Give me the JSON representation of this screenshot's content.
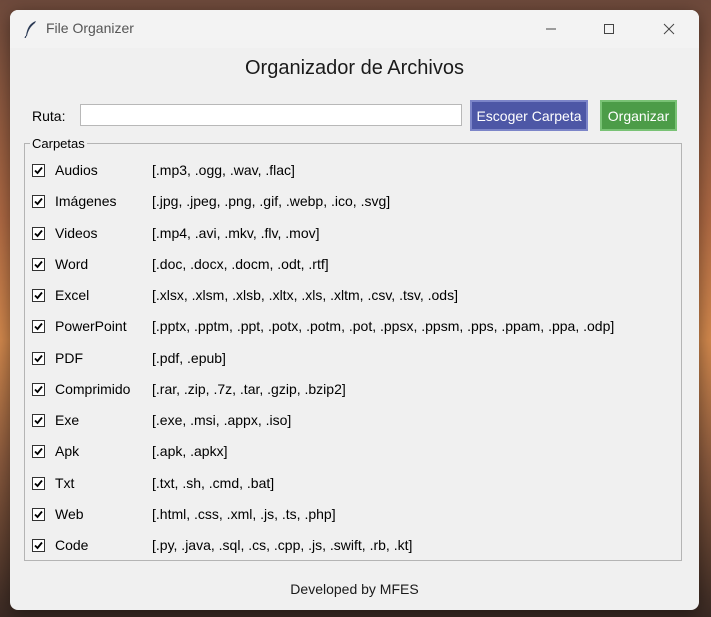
{
  "window": {
    "title": "File Organizer",
    "controls": {
      "minimize_icon": "minimize-icon",
      "maximize_icon": "maximize-icon",
      "close_icon": "close-icon"
    }
  },
  "header": {
    "title": "Organizador de Archivos"
  },
  "path": {
    "label": "Ruta:",
    "value": "",
    "placeholder": ""
  },
  "buttons": {
    "choose_folder": "Escoger Carpeta",
    "organize": "Organizar"
  },
  "colors": {
    "choose_button": "#4d57a6",
    "organize_button": "#4c9c48"
  },
  "folders": {
    "legend": "Carpetas",
    "items": [
      {
        "name": "Audios",
        "extensions": "[.mp3, .ogg, .wav, .flac]",
        "checked": true
      },
      {
        "name": "Imágenes",
        "extensions": "[.jpg, .jpeg, .png, .gif, .webp, .ico, .svg]",
        "checked": true
      },
      {
        "name": "Videos",
        "extensions": "[.mp4, .avi, .mkv, .flv, .mov]",
        "checked": true
      },
      {
        "name": "Word",
        "extensions": "[.doc, .docx, .docm, .odt, .rtf]",
        "checked": true
      },
      {
        "name": "Excel",
        "extensions": "[.xlsx, .xlsm, .xlsb, .xltx, .xls, .xltm, .csv, .tsv, .ods]",
        "checked": true
      },
      {
        "name": "PowerPoint",
        "extensions": "[.pptx, .pptm, .ppt, .potx, .potm, .pot, .ppsx, .ppsm, .pps, .ppam, .ppa, .odp]",
        "checked": true
      },
      {
        "name": "PDF",
        "extensions": "[.pdf, .epub]",
        "checked": true
      },
      {
        "name": "Comprimido",
        "extensions": "[.rar, .zip, .7z, .tar, .gzip, .bzip2]",
        "checked": true
      },
      {
        "name": "Exe",
        "extensions": "[.exe, .msi, .appx, .iso]",
        "checked": true
      },
      {
        "name": "Apk",
        "extensions": "[.apk, .apkx]",
        "checked": true
      },
      {
        "name": "Txt",
        "extensions": "[.txt, .sh, .cmd, .bat]",
        "checked": true
      },
      {
        "name": "Web",
        "extensions": "[.html, .css, .xml, .js, .ts, .php]",
        "checked": true
      },
      {
        "name": "Code",
        "extensions": "[.py, .java, .sql, .cs, .cpp, .js, .swift, .rb, .kt]",
        "checked": true
      }
    ]
  },
  "footer": {
    "text": "Developed by MFES"
  }
}
